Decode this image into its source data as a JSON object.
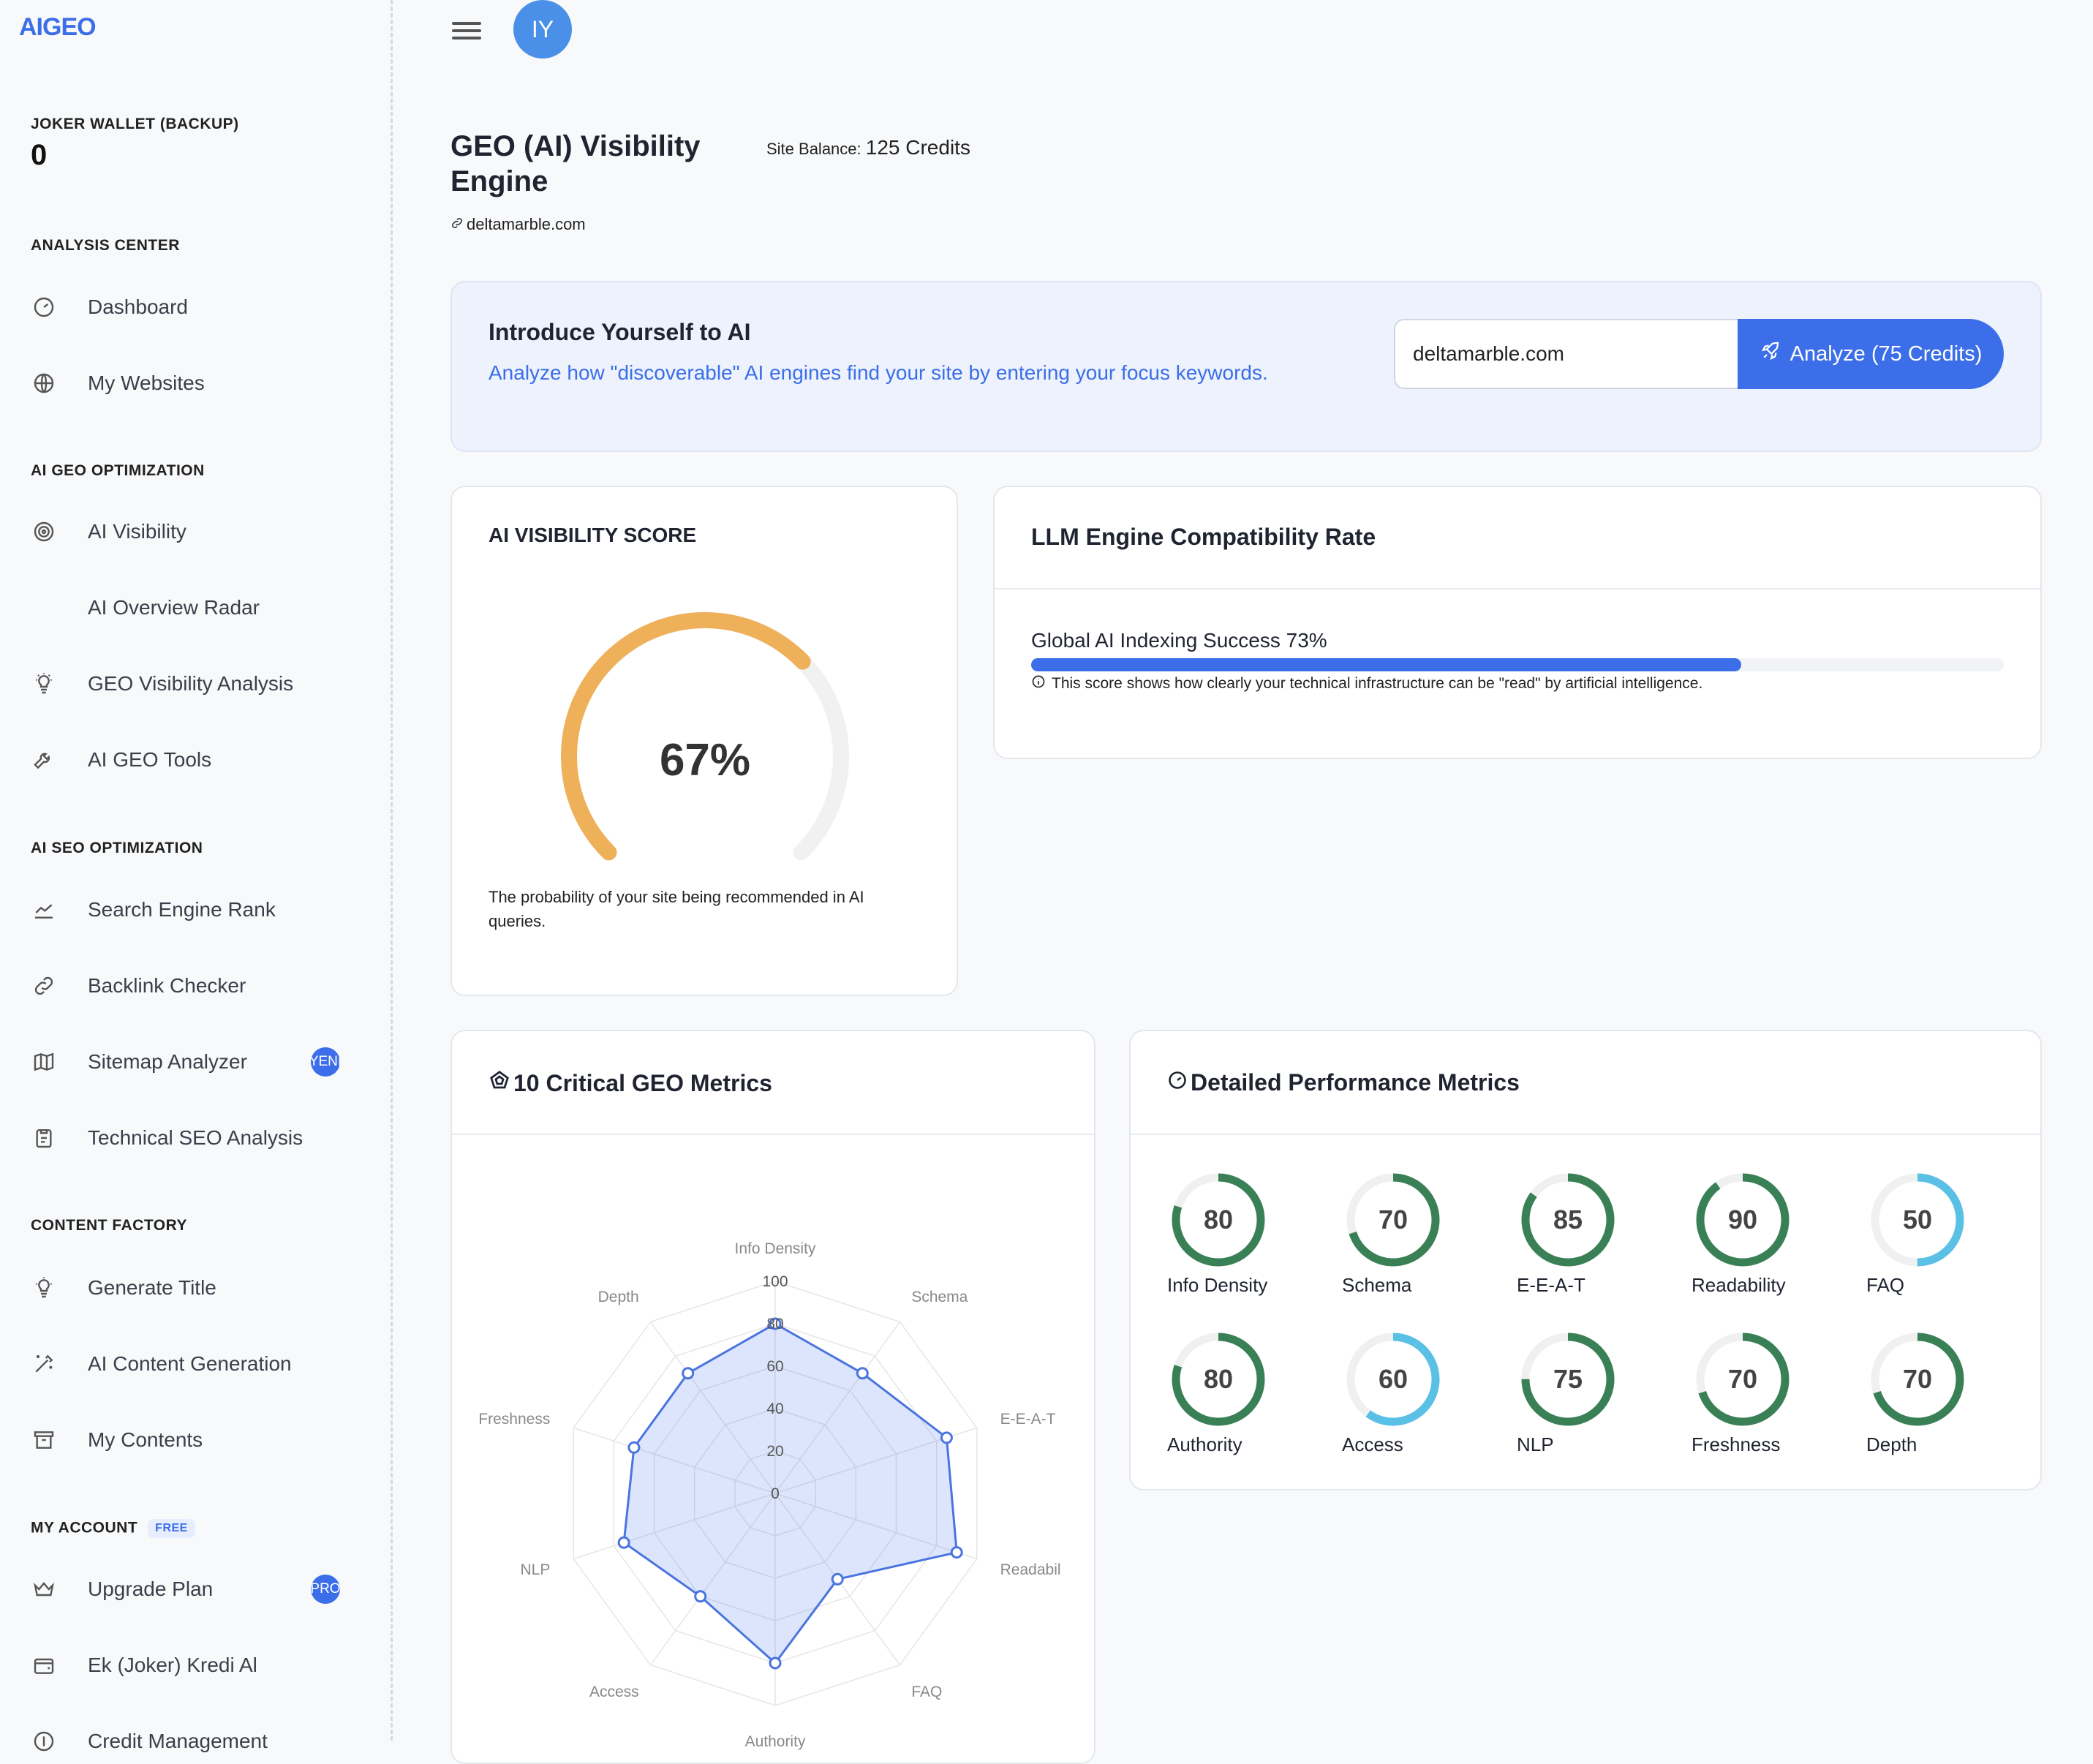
{
  "brand": {
    "logo": "AIGEO",
    "accent": "#3b6ee8"
  },
  "wallet": {
    "label": "JOKER WALLET (BACKUP)",
    "value": "0"
  },
  "sidebar": {
    "analysis_center": "ANALYSIS CENTER",
    "dashboard": "Dashboard",
    "my_websites": "My Websites",
    "ai_geo_optimization": "AI GEO OPTIMIZATION",
    "ai_visibility": "AI Visibility",
    "ai_overview_radar": "AI Overview Radar",
    "geo_visibility_analysis": "GEO Visibility Analysis",
    "ai_geo_tools": "AI GEO Tools",
    "ai_seo_optimization": "AI SEO OPTIMIZATION",
    "search_engine_rank": "Search Engine Rank",
    "backlink_checker": "Backlink Checker",
    "sitemap_analyzer": "Sitemap Analyzer",
    "sitemap_badge": "YENİ",
    "technical_seo": "Technical SEO Analysis",
    "content_factory": "CONTENT FACTORY",
    "generate_title": "Generate Title",
    "ai_content_generation": "AI Content Generation",
    "my_contents": "My Contents",
    "my_account": "MY ACCOUNT",
    "free_badge": "FREE",
    "upgrade_plan": "Upgrade Plan",
    "upgrade_badge": "PRO",
    "ek_kredi": "Ek (Joker) Kredi Al",
    "credit_management": "Credit Management"
  },
  "header": {
    "avatar_initials": "IY"
  },
  "page": {
    "title": "GEO (AI) Visibility Engine",
    "site_balance_label": "Site Balance:",
    "site_balance_value": "125 Credits",
    "site_link": "deltamarble.com"
  },
  "intro": {
    "title": "Introduce Yourself to AI",
    "subtitle": "Analyze how \"discoverable\" AI engines find your site by entering your focus keywords.",
    "input_value": "deltamarble.com",
    "button": "Analyze (75 Credits)"
  },
  "score": {
    "title": "AI VISIBILITY SCORE",
    "value": 67,
    "value_text": "67%",
    "note": "The probability of your site being recommended in AI queries.",
    "color": "#efb05a"
  },
  "llm": {
    "title": "LLM Engine Compatibility Rate",
    "progress_label": "Global AI Indexing Success 73%",
    "progress": 73,
    "note": "This score shows how clearly your technical infrastructure can be \"read\" by artificial intelligence."
  },
  "geo_metrics": {
    "title": "10 Critical GEO Metrics",
    "chart_data": {
      "type": "radar",
      "categories": [
        "Info Density",
        "Schema",
        "E-E-A-T",
        "Readabil",
        "FAQ",
        "Authority",
        "Access",
        "NLP",
        "Freshness",
        "Depth"
      ],
      "values": [
        80,
        70,
        85,
        90,
        50,
        80,
        60,
        75,
        70,
        70
      ],
      "r_ticks": [
        "0",
        "20",
        "40",
        "60",
        "80",
        "100"
      ],
      "rlim": [
        0,
        100
      ]
    }
  },
  "performance": {
    "title": "Detailed Performance Metrics",
    "items": [
      {
        "label": "Info Density",
        "value": 80,
        "color": "#3a8056"
      },
      {
        "label": "Schema",
        "value": 70,
        "color": "#3a8056"
      },
      {
        "label": "E-E-A-T",
        "value": 85,
        "color": "#3a8056"
      },
      {
        "label": "Readability",
        "value": 90,
        "color": "#3a8056"
      },
      {
        "label": "FAQ",
        "value": 50,
        "color": "#5bc0e6"
      },
      {
        "label": "Authority",
        "value": 80,
        "color": "#3a8056"
      },
      {
        "label": "Access",
        "value": 60,
        "color": "#5bc0e6"
      },
      {
        "label": "NLP",
        "value": 75,
        "color": "#3a8056"
      },
      {
        "label": "Freshness",
        "value": 70,
        "color": "#3a8056"
      },
      {
        "label": "Depth",
        "value": 70,
        "color": "#3a8056"
      }
    ]
  }
}
